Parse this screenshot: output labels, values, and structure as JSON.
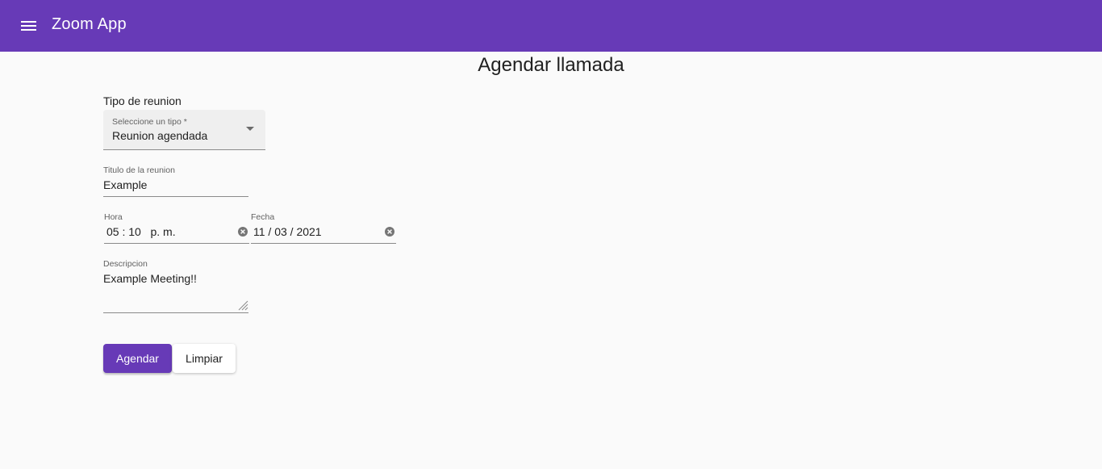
{
  "appbar": {
    "menu_icon": "menu-icon",
    "title": "Zoom App"
  },
  "page": {
    "heading": "Agendar llamada"
  },
  "form": {
    "meeting_type": {
      "section_label": "Tipo de reunion",
      "label": "Seleccione un tipo *",
      "value": "Reunion agendada"
    },
    "title_field": {
      "label": "Titulo de la reunion",
      "value": "Example"
    },
    "hora_field": {
      "label": "Hora",
      "value": "05 : 10   p. m.",
      "clear_icon": "clear-icon"
    },
    "fecha_field": {
      "label": "Fecha",
      "value": "11 / 03 / 2021",
      "clear_icon": "clear-icon"
    },
    "description_field": {
      "label": "Descripcion",
      "value": "Example Meeting!!"
    },
    "buttons": {
      "submit_label": "Agendar",
      "clear_label": "Limpiar"
    }
  },
  "colors": {
    "primary": "#673ab7",
    "background": "#fafafa",
    "text": "#212121"
  }
}
